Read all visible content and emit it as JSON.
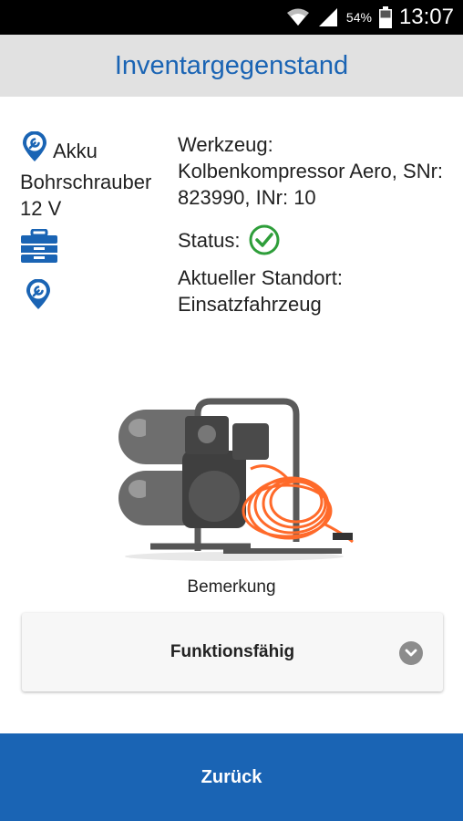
{
  "status_bar": {
    "battery_percent": "54%",
    "time": "13:07"
  },
  "header": {
    "title": "Inventargegenstand"
  },
  "item": {
    "name": "Akku Bohrschrauber 12 V",
    "icons": [
      "location-wrench-icon",
      "toolbox-icon",
      "location-wrench-icon"
    ]
  },
  "details": {
    "werkzeug_label": "Werkzeug:",
    "werkzeug_value": "Kolbenkompressor Aero, SNr: 823990, INr: 10",
    "status_label": "Status:",
    "status_icon": "check-circle-icon",
    "location_label": "Aktueller Standort:",
    "location_value": "Einsatzfahrzeug"
  },
  "remark": {
    "label": "Bemerkung",
    "selected": "Funktionsfähig"
  },
  "footer": {
    "back_label": "Zurück"
  },
  "colors": {
    "accent": "#1a64b4",
    "status_ok": "#2e9e3a",
    "header_bg": "#e1e1e1"
  }
}
